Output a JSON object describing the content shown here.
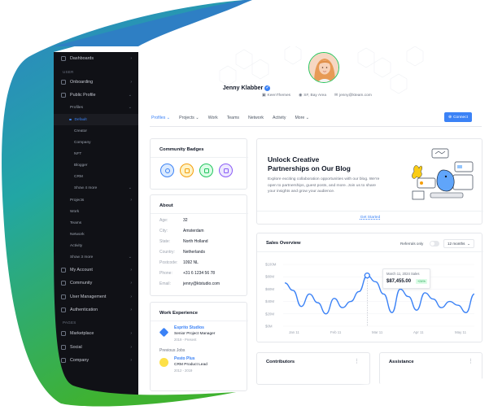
{
  "sidebar": {
    "top_item": "Dashboards",
    "section_user": "USER",
    "items": [
      {
        "label": "Onboarding",
        "icon": "onboarding-icon",
        "chev": "›"
      },
      {
        "label": "Public Profile",
        "icon": "profile-icon",
        "chev": "⌄"
      }
    ],
    "profiles_label": "Profiles",
    "default_label": "Default",
    "sub_items": [
      "Creator",
      "Company",
      "NFT",
      "Blogger",
      "CRM"
    ],
    "show_4_more": "Show 4 more",
    "more_items": [
      "Projects",
      "Work",
      "Teams",
      "Network",
      "Activity"
    ],
    "show_3_more": "Show 3 more",
    "groups": [
      {
        "label": "My Account",
        "icon": "account-icon"
      },
      {
        "label": "Community",
        "icon": "community-icon"
      },
      {
        "label": "User Management",
        "icon": "users-icon"
      },
      {
        "label": "Authentication",
        "icon": "lock-icon"
      }
    ],
    "section_pages": "PAGES",
    "page_items": [
      {
        "label": "Marketplace",
        "icon": "store-icon"
      },
      {
        "label": "Social",
        "icon": "social-icon"
      },
      {
        "label": "Company",
        "icon": "building-icon"
      }
    ]
  },
  "profile": {
    "name": "Jenny Klabber",
    "company": "KeenThemes",
    "location": "SF, Bay Area",
    "email": "jenny@kteam.com"
  },
  "tabs": [
    "Profiles",
    "Projects",
    "Work",
    "Teams",
    "Network",
    "Activity",
    "More"
  ],
  "connect_label": "Connect",
  "badges": {
    "title": "Community Badges",
    "items": [
      {
        "icon": "target-icon",
        "color": "#3b82f6",
        "bg": "#dbeafe"
      },
      {
        "icon": "cards-icon",
        "color": "#f59e0b",
        "bg": "#fef3c7"
      },
      {
        "icon": "leaf-icon",
        "color": "#22c55e",
        "bg": "#dcfce7"
      },
      {
        "icon": "flask-icon",
        "color": "#8b5cf6",
        "bg": "#ede9fe"
      }
    ]
  },
  "about": {
    "title": "About",
    "rows": [
      {
        "k": "Age:",
        "v": "32"
      },
      {
        "k": "City:",
        "v": "Amsterdam"
      },
      {
        "k": "State:",
        "v": "North Holland"
      },
      {
        "k": "Country:",
        "v": "Netherlands"
      },
      {
        "k": "Postcode:",
        "v": "1092 NL"
      },
      {
        "k": "Phone:",
        "v": "+31 6 1234 56 78"
      },
      {
        "k": "Email:",
        "v": "jenny@ktstudio.com"
      }
    ]
  },
  "work": {
    "title": "Work Experience",
    "company": "Esprito Studios",
    "role": "Senior Project Manager",
    "period": "2019 - Present",
    "previous": "Previous Jobs",
    "prev_company": "Pesto Plus",
    "prev_role": "CRM Product Lead",
    "prev_period": "2012 - 2019"
  },
  "blog": {
    "title_line1": "Unlock Creative",
    "title_line2": "Partnerships on Our Blog",
    "body_line1": "Explore exciting collaboration opportunities with our blog. We're",
    "body_line2": "open to partnerships, guest posts, and more. Join us to share",
    "body_line3": "your insights and grow your audience.",
    "cta": "Get Started"
  },
  "sales": {
    "title": "Sales Overview",
    "toggle_label": "Referrals only",
    "period": "12 months",
    "tooltip_date": "March 11, 2024 Sales",
    "tooltip_value": "$87,455.00",
    "tooltip_change": "+24%"
  },
  "chart_data": {
    "type": "line",
    "x": [
      "Jan 11",
      "Feb 11",
      "Mar 11",
      "Apr 11",
      "May 11"
    ],
    "y_ticks": [
      "$100M",
      "$80M",
      "$60M",
      "$40M",
      "$20M",
      "$0M"
    ],
    "ylim": [
      0,
      100
    ],
    "series": [
      {
        "values": [
          70,
          58,
          32,
          52,
          38,
          20,
          45,
          30,
          40,
          56,
          82,
          72,
          52,
          22,
          60,
          48,
          26,
          54,
          44,
          30,
          40,
          34,
          22,
          52
        ]
      }
    ],
    "highlight_index": 10,
    "line_color": "#3b82f6"
  },
  "contributors": {
    "title": "Contributors"
  },
  "assistance": {
    "title": "Assistance"
  }
}
